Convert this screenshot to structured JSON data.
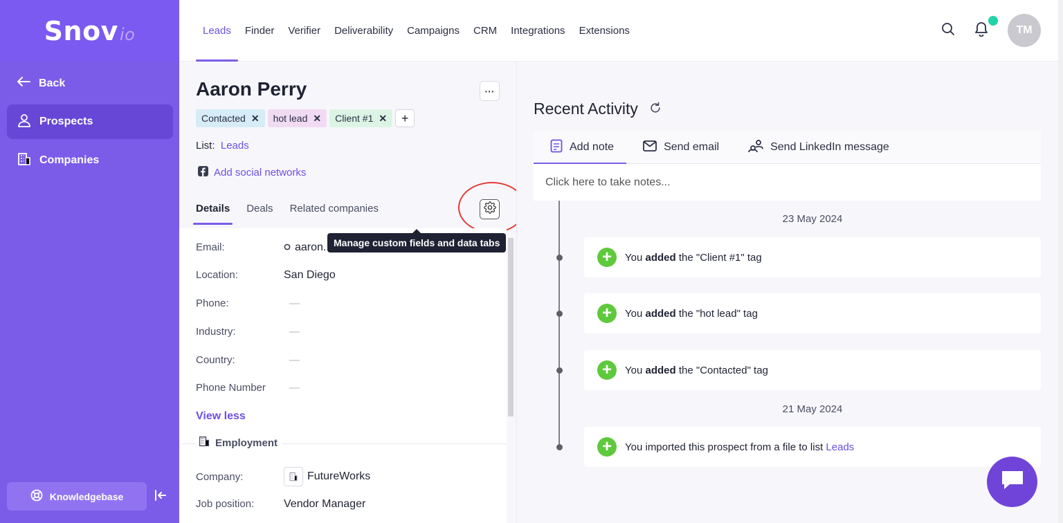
{
  "app": {
    "logo_main": "Snov",
    "logo_suffix": "io"
  },
  "nav": {
    "links": [
      "Leads",
      "Finder",
      "Verifier",
      "Deliverability",
      "Campaigns",
      "CRM",
      "Integrations",
      "Extensions"
    ],
    "active": "Leads",
    "avatar_initials": "TM"
  },
  "sidebar": {
    "back_label": "Back",
    "items": [
      {
        "label": "Prospects",
        "active": true
      },
      {
        "label": "Companies",
        "active": false
      }
    ],
    "knowledgebase_label": "Knowledgebase"
  },
  "prospect": {
    "name": "Aaron Perry",
    "more_label": "···",
    "tags": [
      {
        "label": "Contacted",
        "color": "#d6ecf7"
      },
      {
        "label": "hot lead",
        "color": "#f1dbf3"
      },
      {
        "label": "Client #1",
        "color": "#dcf4e4"
      }
    ],
    "tag_remove": "✕",
    "tag_add": "+",
    "list_label": "List:",
    "list_value": "Leads",
    "social_label": "Add social networks",
    "tabs": [
      "Details",
      "Deals",
      "Related companies"
    ],
    "active_tab": "Details",
    "tooltip": "Manage custom fields and data tabs",
    "fields": [
      {
        "label": "Email:",
        "value": "aaron.",
        "empty": false
      },
      {
        "label": "Location:",
        "value": "San Diego",
        "empty": false
      },
      {
        "label": "Phone:",
        "value": "—",
        "empty": true
      },
      {
        "label": "Industry:",
        "value": "—",
        "empty": true
      },
      {
        "label": "Country:",
        "value": "—",
        "empty": true
      },
      {
        "label": "Phone Number",
        "value": "—",
        "empty": true
      }
    ],
    "view_less": "View less",
    "employment_heading": "Employment",
    "company_label": "Company:",
    "company_value": "FutureWorks",
    "job_label": "Job position:",
    "job_value": "Vendor Manager"
  },
  "activity": {
    "title": "Recent Activity",
    "tabs": [
      "Add note",
      "Send email",
      "Send LinkedIn message"
    ],
    "note_placeholder": "Click here to take notes...",
    "date1": "23 May 2024",
    "date2": "21 May 2024",
    "you": "You",
    "added": "added",
    "items": [
      {
        "rest": "the \"Client #1\" tag"
      },
      {
        "rest": "the \"hot lead\" tag"
      },
      {
        "rest": "the \"Contacted\" tag"
      }
    ],
    "import_text": "You imported this prospect from a file to list",
    "import_link": "Leads"
  },
  "colors": {
    "accent": "#7b5ce8",
    "link": "#6d4fe6",
    "success": "#5fc93d",
    "notify": "#22d3a6"
  }
}
